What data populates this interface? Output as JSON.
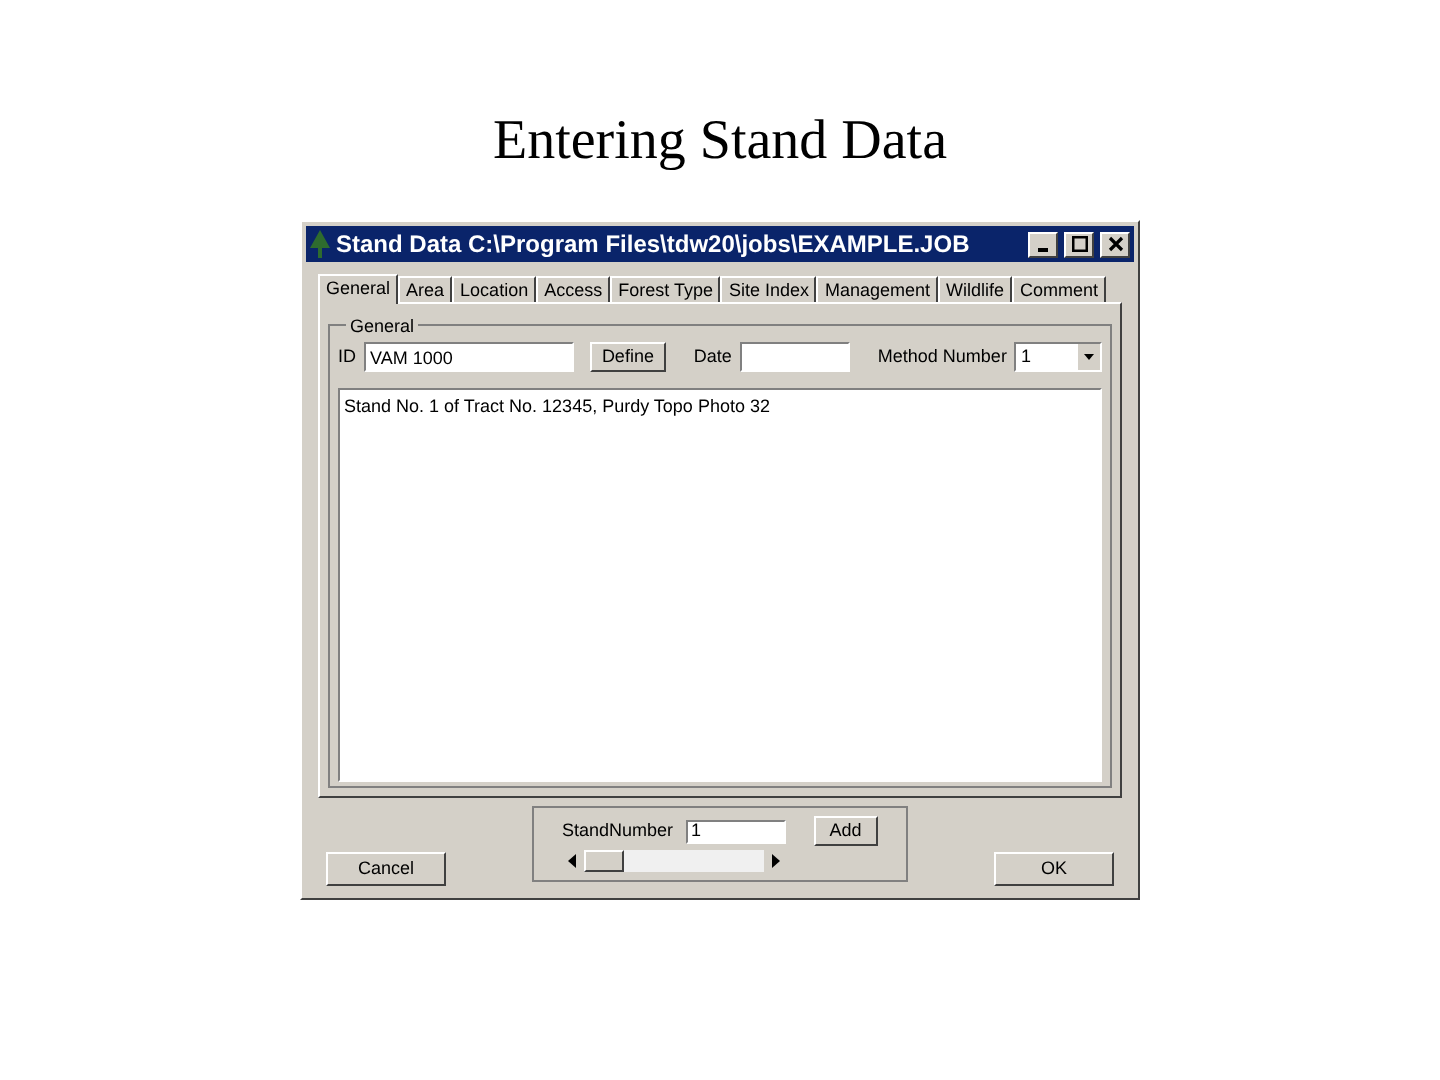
{
  "slide_title": "Entering Stand Data",
  "window": {
    "title": "Stand Data C:\\Program Files\\tdw20\\jobs\\EXAMPLE.JOB"
  },
  "tabs": [
    {
      "label": "General",
      "selected": true
    },
    {
      "label": "Area",
      "selected": false
    },
    {
      "label": "Location",
      "selected": false
    },
    {
      "label": "Access",
      "selected": false
    },
    {
      "label": "Forest Type",
      "selected": false
    },
    {
      "label": "Site Index",
      "selected": false
    },
    {
      "label": "Management",
      "selected": false
    },
    {
      "label": "Wildlife",
      "selected": false
    },
    {
      "label": "Comment",
      "selected": false
    }
  ],
  "group": {
    "title": "General",
    "id_label": "ID",
    "id_value": "VAM 1000",
    "define_button": "Define",
    "date_label": "Date",
    "method_label": "Method Number",
    "method_value": "1"
  },
  "memo": "Stand No. 1 of Tract No. 12345, Purdy Topo Photo 32",
  "footer": {
    "cancel": "Cancel",
    "stand_label": "StandNumber",
    "stand_value": "1",
    "add": "Add",
    "ok": "OK"
  }
}
